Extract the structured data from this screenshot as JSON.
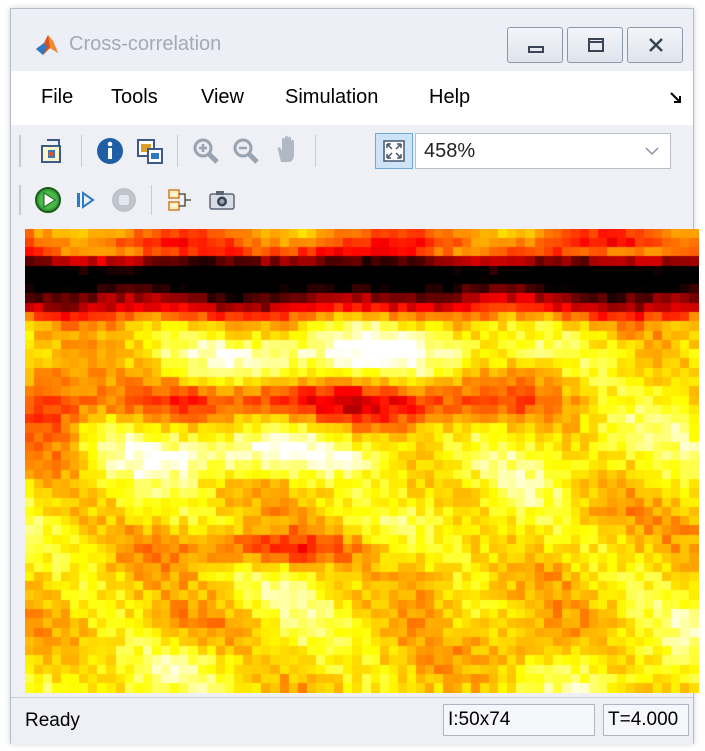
{
  "window": {
    "title": "Cross-correlation",
    "icon": "matlab-icon"
  },
  "title_buttons": [
    {
      "name": "minimize-button",
      "icon": "minimize-icon"
    },
    {
      "name": "maximize-button",
      "icon": "maximize-icon"
    },
    {
      "name": "close-button",
      "icon": "close-icon"
    }
  ],
  "menu": {
    "items": [
      "File",
      "Tools",
      "View",
      "Simulation",
      "Help"
    ]
  },
  "toolbar": {
    "buttons": [
      {
        "name": "highlight-simulink-block",
        "icon": "model-icon"
      },
      {
        "name": "info",
        "icon": "info-icon"
      },
      {
        "name": "export-to-image-viewer",
        "icon": "export-image-icon"
      },
      {
        "name": "zoom-in",
        "icon": "zoom-in-icon"
      },
      {
        "name": "zoom-out",
        "icon": "zoom-out-icon"
      },
      {
        "name": "pan",
        "icon": "hand-icon"
      },
      {
        "name": "fit-to-view",
        "icon": "fit-to-view-icon"
      }
    ],
    "zoom_value": "458%"
  },
  "playback": {
    "buttons": [
      {
        "name": "run",
        "icon": "play-icon"
      },
      {
        "name": "step-forward",
        "icon": "step-forward-icon"
      },
      {
        "name": "stop",
        "icon": "stop-icon"
      },
      {
        "name": "signal-selector",
        "icon": "signal-selector-icon"
      },
      {
        "name": "snapshot",
        "icon": "camera-icon"
      }
    ]
  },
  "display": {
    "description": "hot colormap intensity image",
    "colormap": "hot",
    "colors": {
      "black": "#000000",
      "dark_red": "#6a0000",
      "red": "#e00000",
      "orange": "#ff6a00",
      "yellow": "#ffd800",
      "pale_yellow": "#ffffa0"
    }
  },
  "status": {
    "text": "Ready",
    "dimensions": "I:50x74",
    "time": "T=4.000"
  }
}
